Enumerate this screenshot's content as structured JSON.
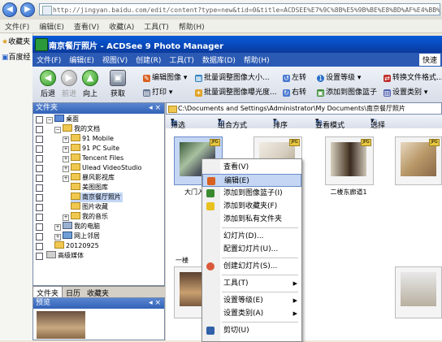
{
  "browser": {
    "url": "http://jingyan.baidu.com/edit/content?type=new&tid=0&title=ACDSEE%E7%9C%8B%E5%9B%BE%E8%BD%AF%E4%BB%B6%E6%80%8E%E4%B9%88%E6%B7%BB%E5%8A%A0%E5%9B%BE%E7%89%87",
    "menu": [
      "文件(F)",
      "编辑(E)",
      "查看(V)",
      "收藏(A)",
      "工具(T)",
      "帮助(H)"
    ],
    "favorites_label": "收藏夹",
    "fav_items": [
      "收藏夹",
      "百度经"
    ]
  },
  "app": {
    "title": "南京餐厅照片 - ACDSee 9 Photo Manager",
    "menu": [
      "文件(F)",
      "编辑(E)",
      "视图(V)",
      "创建(R)",
      "工具(T)",
      "数据库(D)",
      "帮助(H)"
    ],
    "quick_search": "快速",
    "toolbar": {
      "back": "后退",
      "forward": "前进",
      "up": "向上",
      "acquire": "获取",
      "edit_image": "编辑图像",
      "print": "打印",
      "batch_resize": "批量调整图像大小...",
      "batch_exposure": "批量调整图像曝光度...",
      "rotate_left": "左转",
      "rotate_right": "右转",
      "set_rating": "设置等级",
      "add_to_basket": "添加到图像篮子",
      "convert_format": "转换文件格式...",
      "set_category": "设置类别"
    },
    "folders": {
      "header": "文件夹",
      "tree": [
        "桌面",
        "我的文档",
        "91 Mobile",
        "91 PC Suite",
        "Tencent Files",
        "Ulead VideoStudio",
        "暴风影视库",
        "美图图库",
        "南京餐厅照片",
        "图片收藏",
        "我的音乐",
        "我的电脑",
        "网上邻居",
        "20120925",
        "高级媒体"
      ]
    },
    "pane_tabs": [
      "文件夹",
      "日历",
      "收藏夹"
    ],
    "preview_header": "预览",
    "path": "C:\\Documents and Settings\\Administrator\\My Documents\\南京餐厅照片",
    "filter_bar": [
      "筛选",
      "组合方式",
      "排序",
      "查看模式",
      "选择"
    ],
    "thumbs": [
      {
        "caption": "大门入口"
      },
      {
        "caption": ""
      },
      {
        "caption": "二楼东廊道1"
      },
      {
        "caption": ""
      },
      {
        "caption": "一楼"
      }
    ],
    "thumb_tag": "JPG",
    "context_menu": [
      {
        "label": "查看(V)",
        "arrow": false
      },
      {
        "label": "编辑(E)",
        "arrow": false,
        "highlighted": true
      },
      {
        "label": "添加到图像篮子(I)",
        "arrow": false
      },
      {
        "label": "添加到收藏夹(F)",
        "arrow": false
      },
      {
        "label": "添加到私有文件夹",
        "arrow": false
      },
      {
        "label": "幻灯片(D)...",
        "arrow": false
      },
      {
        "label": "配置幻灯片(U)...",
        "arrow": false
      },
      {
        "label": "创建幻灯片(S)...",
        "arrow": false
      },
      {
        "label": "工具(T)",
        "arrow": true
      },
      {
        "label": "设置等级(E)",
        "arrow": true
      },
      {
        "label": "设置类别(A)",
        "arrow": true
      },
      {
        "label": "剪切(U)",
        "arrow": false
      }
    ],
    "arrow_glyph": "▶",
    "colors": {
      "title_bar": "#0847b8",
      "menu_bar": "#2b5ab4",
      "highlight": "#c4d6f4"
    }
  }
}
